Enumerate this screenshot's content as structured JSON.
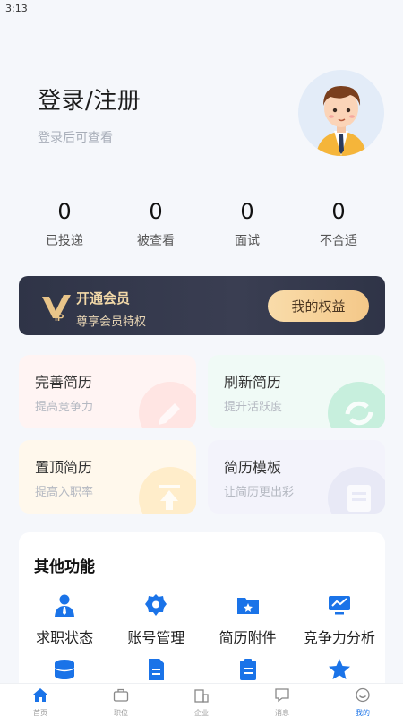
{
  "status_bar": {
    "time": "3:13"
  },
  "header": {
    "title": "登录/注册",
    "subtitle": "登录后可查看"
  },
  "stats": [
    {
      "value": "0",
      "label": "已投递"
    },
    {
      "value": "0",
      "label": "被查看"
    },
    {
      "value": "0",
      "label": "面试"
    },
    {
      "value": "0",
      "label": "不合适"
    }
  ],
  "vip": {
    "title": "开通会员",
    "subtitle": "尊享会员特权",
    "button": "我的权益"
  },
  "cards": [
    {
      "title": "完善简历",
      "subtitle": "提高竞争力"
    },
    {
      "title": "刷新简历",
      "subtitle": "提升活跃度"
    },
    {
      "title": "置顶简历",
      "subtitle": "提高入职率"
    },
    {
      "title": "简历模板",
      "subtitle": "让简历更出彩"
    }
  ],
  "other": {
    "title": "其他功能",
    "items": [
      {
        "label": "求职状态",
        "icon": "person-tie-icon"
      },
      {
        "label": "账号管理",
        "icon": "gear-icon"
      },
      {
        "label": "简历附件",
        "icon": "folder-star-icon"
      },
      {
        "label": "竞争力分析",
        "icon": "chart-monitor-icon"
      },
      {
        "label": "",
        "icon": "database-icon"
      },
      {
        "label": "",
        "icon": "document-icon"
      },
      {
        "label": "",
        "icon": "clipboard-icon"
      },
      {
        "label": "",
        "icon": "star-icon"
      }
    ]
  },
  "tabbar": [
    {
      "label": "首页",
      "icon": "home-icon"
    },
    {
      "label": "职位",
      "icon": "briefcase-icon"
    },
    {
      "label": "企业",
      "icon": "building-icon"
    },
    {
      "label": "消息",
      "icon": "message-icon"
    },
    {
      "label": "我的",
      "icon": "face-icon",
      "active": true
    }
  ],
  "colors": {
    "accent": "#1a73e8",
    "vip_bg": "#2f3447",
    "vip_gold": "#f3d9a8"
  }
}
